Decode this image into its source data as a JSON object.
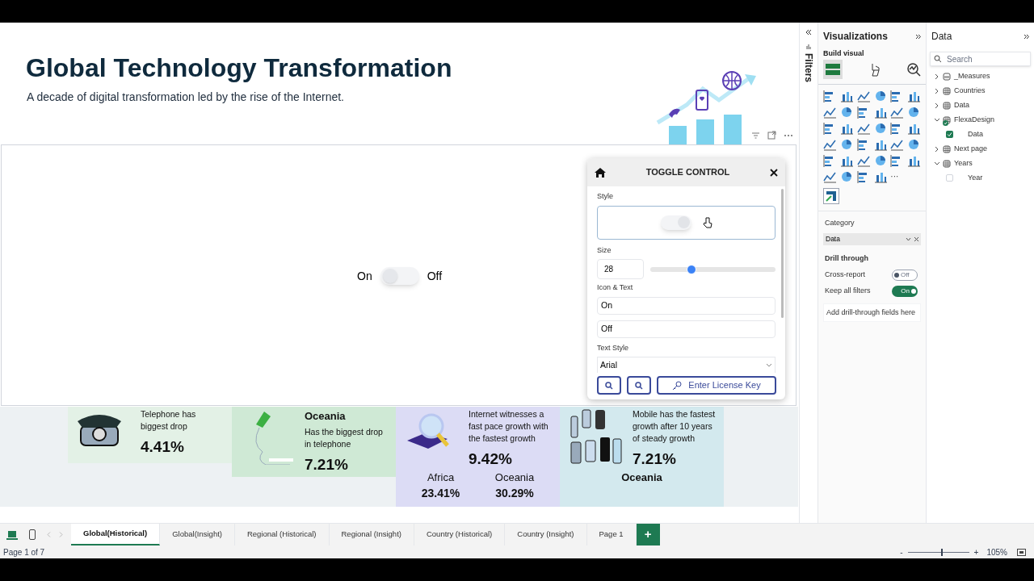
{
  "report": {
    "title": "Global Technology Transformation",
    "subtitle": "A decade of digital transformation led by the rise of the Internet."
  },
  "toggle_visual": {
    "on_label": "On",
    "off_label": "Off",
    "on": false
  },
  "toggle_control": {
    "title": "TOGGLE CONTROL",
    "style_label": "Style",
    "size": {
      "label": "Size",
      "value": "28",
      "level": 0.33
    },
    "icon_text": {
      "label": "Icon & Text",
      "on_text": "On",
      "off_text": "Off"
    },
    "text_style": {
      "label": "Text Style",
      "value": "Arial"
    },
    "license_button": "Enter License Key"
  },
  "cards": [
    {
      "kind": "telephone",
      "text": "Telephone has biggest drop",
      "value": "4.41%"
    },
    {
      "kind": "handset",
      "heading": "Oceania",
      "text": "Has the biggest drop in telephone",
      "value": "7.21%"
    },
    {
      "kind": "tablet",
      "text": "Internet witnesses a fast pace growth with the fastest growth",
      "value": "9.42%",
      "regions": [
        {
          "name": "Africa",
          "value": "23.41%"
        },
        {
          "name": "Oceania",
          "value": "30.29%"
        }
      ]
    },
    {
      "kind": "mobiles",
      "text": "Mobile has the fastest growth after 10 years of steady growth",
      "value": "7.21%",
      "regions": [
        {
          "name": "Oceania"
        }
      ]
    }
  ],
  "filters_pane": {
    "label": "Filters"
  },
  "visualizations": {
    "title": "Visualizations",
    "build_visual": "Build visual",
    "more": "···",
    "category": {
      "label": "Category",
      "value": "Data"
    },
    "drill_through": {
      "title": "Drill through",
      "options": [
        {
          "label": "Cross-report",
          "on": false,
          "state_text": "Off"
        },
        {
          "label": "Keep all filters",
          "on": true,
          "state_text": "On"
        }
      ],
      "add_fields": "Add drill-through fields here"
    }
  },
  "data_pane": {
    "title": "Data",
    "search_placeholder": "Search",
    "tables": [
      {
        "name": "_Measures",
        "kind": "measures",
        "expanded": false,
        "checked": false
      },
      {
        "name": "Countries",
        "kind": "table",
        "expanded": false,
        "checked": false
      },
      {
        "name": "Data",
        "kind": "table",
        "expanded": false,
        "checked": false
      },
      {
        "name": "FlexaDesign",
        "kind": "table",
        "expanded": true,
        "checked": true,
        "children": [
          {
            "name": "Data",
            "checked": true
          }
        ]
      },
      {
        "name": "Next page",
        "kind": "table",
        "expanded": false,
        "checked": false
      },
      {
        "name": "Years",
        "kind": "table",
        "expanded": true,
        "checked": false,
        "children": [
          {
            "name": "Year",
            "checked": false
          }
        ]
      }
    ]
  },
  "page_tabs": [
    {
      "label": "Global(Historical)",
      "selected": true
    },
    {
      "label": "Global(Insight)",
      "selected": false
    },
    {
      "label": "Regional (Historical)",
      "selected": false
    },
    {
      "label": "Regional (Insight)",
      "selected": false
    },
    {
      "label": "Country (Historical)",
      "selected": false
    },
    {
      "label": "Country (Insight)",
      "selected": false
    },
    {
      "label": "Page 1",
      "selected": false
    }
  ],
  "add_page": "+",
  "status_bar": {
    "page": "Page 1 of 7",
    "zoom_minus": "-",
    "zoom_plus": "+",
    "zoom": "105%",
    "zoom_level": {
      "level": 0.55
    }
  }
}
